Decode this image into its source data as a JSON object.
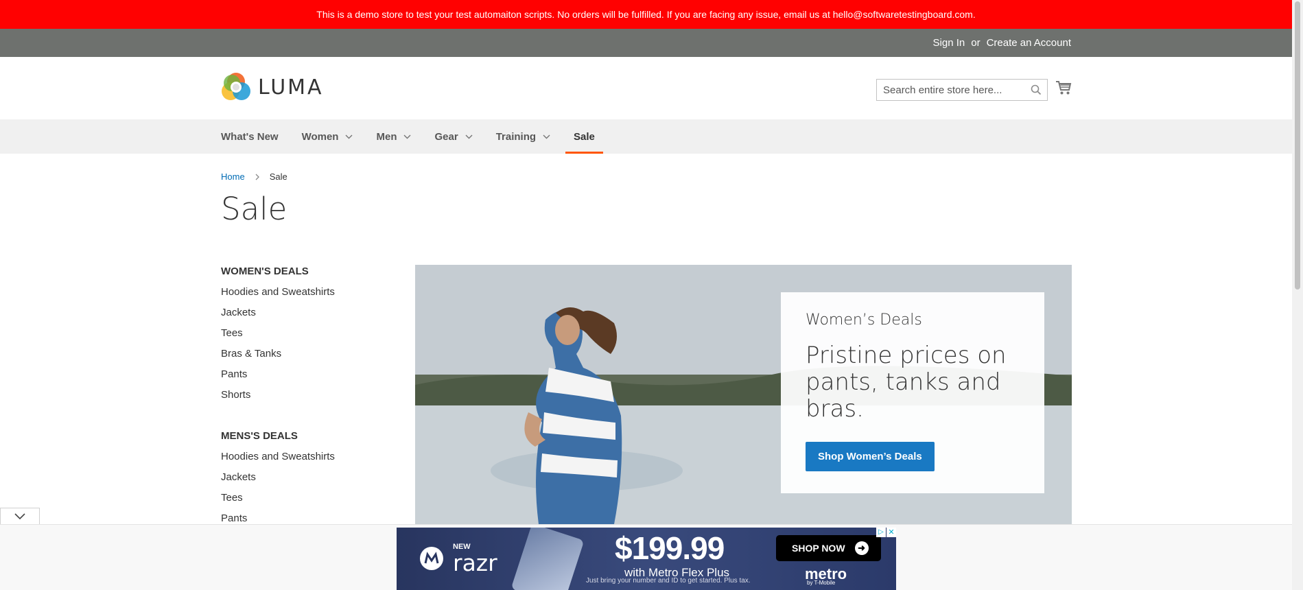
{
  "demo_notice": "This is a demo store to test your test automaiton scripts. No orders will be fulfilled. If you are facing any issue, email us at hello@softwaretestingboard.com.",
  "header": {
    "sign_in": "Sign In",
    "separator": "or",
    "create_account": "Create an Account"
  },
  "logo": {
    "text": "LUMA"
  },
  "search": {
    "placeholder": "Search entire store here...",
    "value": ""
  },
  "nav": {
    "items": [
      {
        "label": "What's New",
        "has_dropdown": false
      },
      {
        "label": "Women",
        "has_dropdown": true
      },
      {
        "label": "Men",
        "has_dropdown": true
      },
      {
        "label": "Gear",
        "has_dropdown": true
      },
      {
        "label": "Training",
        "has_dropdown": true
      },
      {
        "label": "Sale",
        "has_dropdown": false,
        "active": true
      }
    ]
  },
  "breadcrumb": {
    "home": "Home",
    "current": "Sale"
  },
  "page_title": "Sale",
  "sidebar": {
    "womens_title": "WOMEN'S DEALS",
    "womens_links": [
      "Hoodies and Sweatshirts",
      "Jackets",
      "Tees",
      "Bras & Tanks",
      "Pants",
      "Shorts"
    ],
    "mens_title": "MENS'S DEALS",
    "mens_links": [
      "Hoodies and Sweatshirts",
      "Jackets",
      "Tees",
      "Pants"
    ]
  },
  "hero": {
    "subtitle": "Women’s Deals",
    "title": "Pristine prices on pants, tanks and bras.",
    "button": "Shop Women’s Deals"
  },
  "ad": {
    "new": "NEW",
    "product": "razr",
    "price": "$199.99",
    "plan": "with Metro Flex Plus",
    "fine_print": "Just bring your number and ID to get started. Plus tax.",
    "cta": "SHOP NOW",
    "brand": "metro",
    "brand_sub": "by T-Mobile"
  },
  "colors": {
    "demo_bar": "#ff0101",
    "header_bar": "#6e716e",
    "nav_bg": "#f0f0f0",
    "active_underline": "#ff5501",
    "link_blue": "#006bb4",
    "button_blue": "#1979c3"
  }
}
